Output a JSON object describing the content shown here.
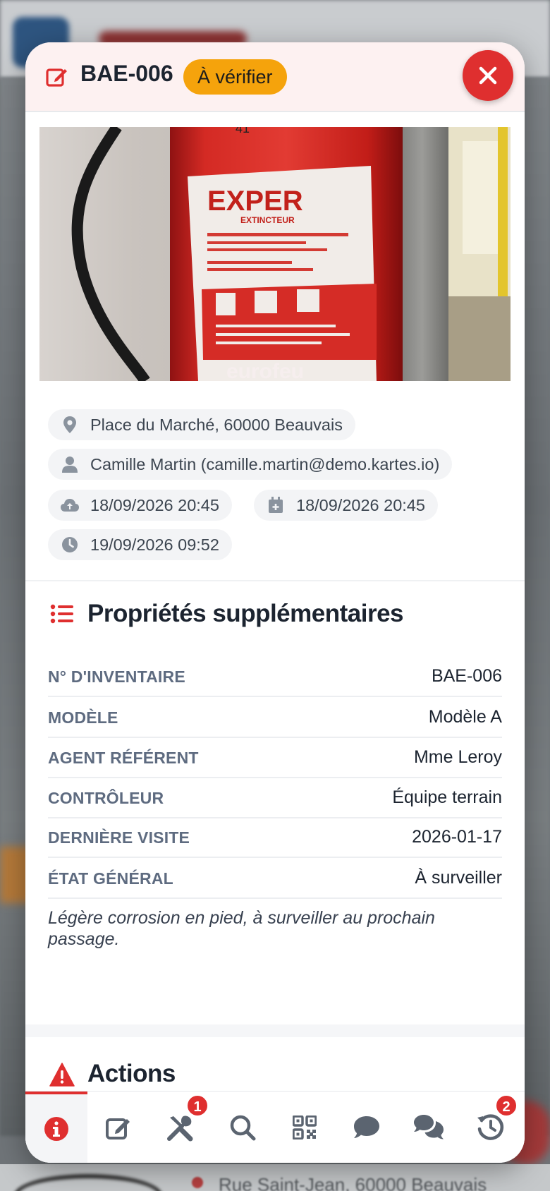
{
  "header": {
    "title": "BAE-006",
    "status": "À vérifier",
    "close_label": "Fermer"
  },
  "photo": {
    "brand_text": "EXPER",
    "sub_text": "EXTINCTEUR",
    "bottom_text": "eurofeu"
  },
  "meta": {
    "address": "Place du Marché, 60000 Beauvais",
    "user": "Camille Martin (camille.martin@demo.kartes.io)",
    "uploaded": "18/09/2026 20:45",
    "created": "18/09/2026 20:45",
    "updated": "19/09/2026 09:52"
  },
  "properties": {
    "title": "Propriétés supplémentaires",
    "rows": [
      {
        "label": "N° D'INVENTAIRE",
        "value": "BAE-006"
      },
      {
        "label": "MODÈLE",
        "value": "Modèle A"
      },
      {
        "label": "AGENT RÉFÉRENT",
        "value": "Mme Leroy"
      },
      {
        "label": "CONTRÔLEUR",
        "value": "Équipe terrain"
      },
      {
        "label": "DERNIÈRE VISITE",
        "value": "2026-01-17"
      },
      {
        "label": "ÉTAT GÉNÉRAL",
        "value": "À surveiller"
      }
    ],
    "note": "Légère corrosion en pied, à surveiller au prochain passage."
  },
  "actions": {
    "title": "Actions"
  },
  "nav": {
    "items": [
      {
        "icon": "info-icon",
        "active": true
      },
      {
        "icon": "edit-icon"
      },
      {
        "icon": "tools-icon",
        "badge": "1"
      },
      {
        "icon": "search-icon"
      },
      {
        "icon": "qrcode-icon"
      },
      {
        "icon": "comment-icon"
      },
      {
        "icon": "comments-icon"
      },
      {
        "icon": "history-icon",
        "badge": "2"
      }
    ]
  },
  "background": {
    "address_preview": "Rue Saint-Jean, 60000 Beauvais"
  },
  "colors": {
    "accent": "#df2f2f",
    "status_badge": "#f5a30c",
    "primary": "#1c55d0",
    "icon_gray": "#8a939e"
  }
}
